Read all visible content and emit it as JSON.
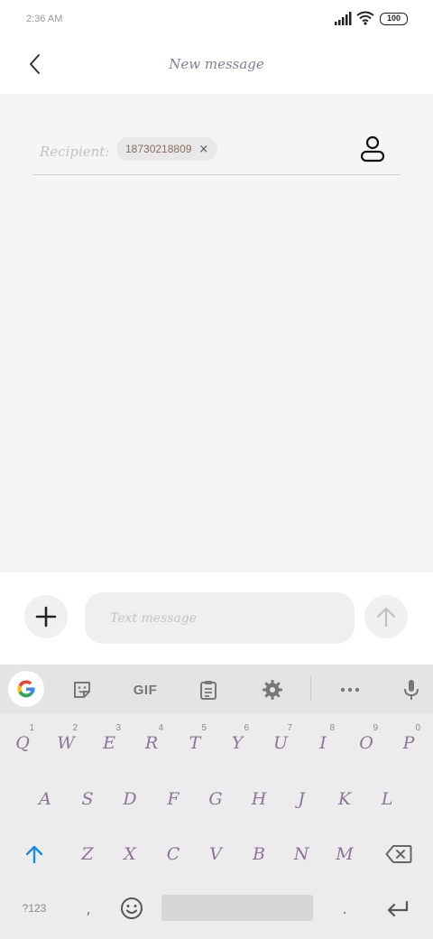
{
  "status_bar": {
    "time": "2:36 AM",
    "battery": "100"
  },
  "header": {
    "title": "New message",
    "back_icon": "chevron-left-icon"
  },
  "recipient": {
    "label": "Recipient:",
    "chip_value": "18730218809",
    "chip_close": "×",
    "contact_icon": "person-icon"
  },
  "composer": {
    "placeholder": "Text message",
    "add_icon": "plus-icon",
    "send_icon": "arrow-up-icon"
  },
  "keyboard": {
    "toolbar": {
      "gif_label": "GIF",
      "icons": [
        "google-icon",
        "sticker-icon",
        "gif-icon",
        "clipboard-icon",
        "gear-icon",
        "more-icon",
        "mic-icon"
      ]
    },
    "row1": [
      {
        "key": "Q",
        "hint": "1"
      },
      {
        "key": "W",
        "hint": "2"
      },
      {
        "key": "E",
        "hint": "3"
      },
      {
        "key": "R",
        "hint": "4"
      },
      {
        "key": "T",
        "hint": "5"
      },
      {
        "key": "Y",
        "hint": "6"
      },
      {
        "key": "U",
        "hint": "7"
      },
      {
        "key": "I",
        "hint": "8"
      },
      {
        "key": "O",
        "hint": "9"
      },
      {
        "key": "P",
        "hint": "0"
      }
    ],
    "row2": [
      "A",
      "S",
      "D",
      "F",
      "G",
      "H",
      "J",
      "K",
      "L"
    ],
    "row3": [
      "Z",
      "X",
      "C",
      "V",
      "B",
      "N",
      "M"
    ],
    "bottom": {
      "num_label": "?123",
      "comma": ",",
      "period": "."
    },
    "accent_color": "#1a8be6",
    "key_color": "#8d7397"
  }
}
